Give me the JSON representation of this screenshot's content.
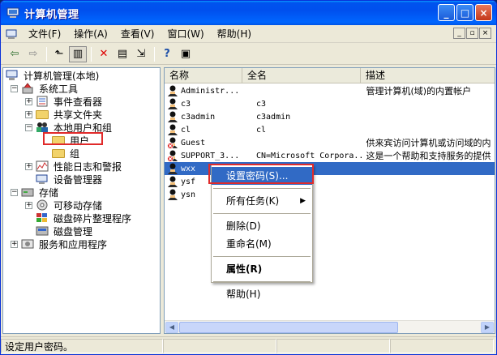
{
  "window": {
    "title": "计算机管理",
    "controls": [
      "_",
      "□",
      "×"
    ]
  },
  "menubar": {
    "items": [
      {
        "label": "文件(F)"
      },
      {
        "label": "操作(A)"
      },
      {
        "label": "查看(V)"
      },
      {
        "label": "窗口(W)"
      },
      {
        "label": "帮助(H)"
      }
    ],
    "mdi_controls": [
      "_",
      "▫",
      "×"
    ]
  },
  "toolbar": {
    "back": "⇦",
    "forward": "⇨",
    "up": "⬑",
    "show_tree": "▥",
    "delete": "✕",
    "properties": "▤",
    "export": "⇲",
    "help": "?",
    "console": "▣"
  },
  "tree": {
    "root": "计算机管理(本地)",
    "system_tools": "系统工具",
    "event_viewer": "事件查看器",
    "shared_folders": "共享文件夹",
    "local_users": "本地用户和组",
    "users": "用户",
    "groups": "组",
    "perf_logs": "性能日志和警报",
    "device_manager": "设备管理器",
    "storage": "存储",
    "removable": "可移动存储",
    "defrag": "磁盘碎片整理程序",
    "disk_mgmt": "磁盘管理",
    "services": "服务和应用程序"
  },
  "list": {
    "columns": [
      "名称",
      "全名",
      "描述"
    ],
    "rows": [
      {
        "name": "Administr...",
        "full": "",
        "desc": "管理计算机(域)的内置帐户",
        "disabled": false
      },
      {
        "name": "c3",
        "full": "c3",
        "desc": "",
        "disabled": false
      },
      {
        "name": "c3admin",
        "full": "c3admin",
        "desc": "",
        "disabled": false
      },
      {
        "name": "cl",
        "full": "cl",
        "desc": "",
        "disabled": false
      },
      {
        "name": "Guest",
        "full": "",
        "desc": "供来宾访问计算机或访问域的内",
        "disabled": true
      },
      {
        "name": "SUPPORT_3...",
        "full": "CN=Microsoft Corpora...",
        "desc": "这是一个帮助和支持服务的提供",
        "disabled": true
      },
      {
        "name": "wxx",
        "full": "",
        "desc": "",
        "disabled": false
      },
      {
        "name": "ysf",
        "full": "",
        "desc": "",
        "disabled": false
      },
      {
        "name": "ysn",
        "full": "",
        "desc": "",
        "disabled": false
      }
    ]
  },
  "context_menu": {
    "set_password": "设置密码(S)...",
    "all_tasks": "所有任务(K)",
    "delete": "删除(D)",
    "rename": "重命名(M)",
    "properties": "属性(R)",
    "help": "帮助(H)"
  },
  "statusbar": {
    "text": "设定用户密码。"
  },
  "colors": {
    "selection": "#316ac5",
    "highlight_box": "#e02a2a",
    "titlebar": "#0053ee"
  }
}
